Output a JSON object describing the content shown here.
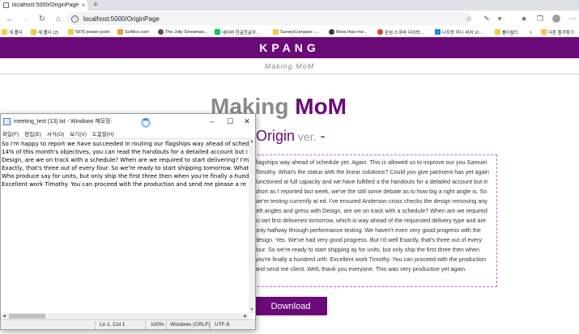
{
  "browser": {
    "tab": {
      "title": "localhost:5000/OriginPage",
      "close": "×"
    },
    "new_tab": "+",
    "nav": {
      "back": "←",
      "forward": "→",
      "reload": "↻",
      "home": "⌂"
    },
    "url": "localhost:5000/OriginPage",
    "bookmarks": [
      {
        "label": "새 폴더",
        "color": "#f2c94c"
      },
      {
        "label": "새 폴더 (2)",
        "color": "#f2c94c"
      },
      {
        "label": "5970 power point",
        "color": "#f2c94c"
      },
      {
        "label": "SciMce.com",
        "color": "#e8a33d"
      },
      {
        "label": "The Jolly Snowman...",
        "color": "#6d4c41"
      },
      {
        "label": "네이버 한글한글아...",
        "color": "#03c75a"
      },
      {
        "label": "SurveyCompare -...",
        "color": "#f2c94c"
      },
      {
        "label": "More than me...",
        "color": "#3b3b3b"
      },
      {
        "label": "몬섬 스쿠버 다이빙...",
        "color": "#e53935"
      },
      {
        "label": "나트랑 미니 비치 VI...",
        "color": "#1e88e5"
      },
      {
        "label": "롤이월드",
        "color": "#f2c94c"
      },
      {
        "label": "다른 즐겨찾기",
        "color": "#f2c94c"
      }
    ],
    "bookmarks_more": "›",
    "right_icons": [
      "☆",
      "✎",
      "▾",
      "★",
      "❐",
      "⋯"
    ]
  },
  "page": {
    "brand": "KPANG",
    "subtitle": "Making MoM",
    "hero_word1": "Making",
    "hero_word2": "MoM",
    "subhead_main": "Origin",
    "subhead_ver": " ver.",
    "subhead_dash": " -",
    "body_text": "flagships way ahead of schedule yet. Again. This is allowed us to improve our you Samuel Timothy. What's the status with the linear solutions? Could you give partment has yet again functioned at full capacity and we have fulfilled a the handouts for a detailed account but in short as I reported last week, we've the still some debate as to how big a right angle is. So we're testing currently at ed. I've ensured Anderson cross checks the design removing any left angles and gress with Design, are we on track with a schedule? When are we required to tart first deliveries tomorrow, which is way ahead of the requested delivery type and are only halfway through performance testing. We haven't even very good progress with the design. Yes. We've had very good progress. But I'd well Exactly, that's three out of every four. So we're ready to start shipping ay for units, but only ship the first three then when you're finally a hundred urth. Excellent work Timothy. You can proceed with the production and send me client. Well, thank you everyone. This was very productive yet again.",
    "download_label": "Download"
  },
  "notepad": {
    "title": "meeting_test (13).txt - Windows 메모장",
    "controls": {
      "minimize": "–",
      "maximize": "☐",
      "close": "✕"
    },
    "menu": [
      "파일(F)",
      "편집(E)",
      "서식(O)",
      "보기(V)",
      "도움말(H)"
    ],
    "lines": [
      "So I'm happy to report we have succeeded in routing our flagships way ahead of schedu",
      "14% of this month's objectives, you can read the handouts for a detailed account but i",
      "Design, are we on track with a schedule? When are we required to start delivering? I'm",
      "Exactly, that's three out of every four. So we're ready to start shipping tomorrow. What",
      "Who produce say for units, but only ship the first three then when you're finally a hund",
      "Excellent work Timothy. You can proceed with the production and send me please a re"
    ],
    "status": {
      "position": "Ln 1, Col 1",
      "zoom": "100%",
      "eol": "Windows (CRLF)",
      "encoding": "UTF-8"
    }
  }
}
